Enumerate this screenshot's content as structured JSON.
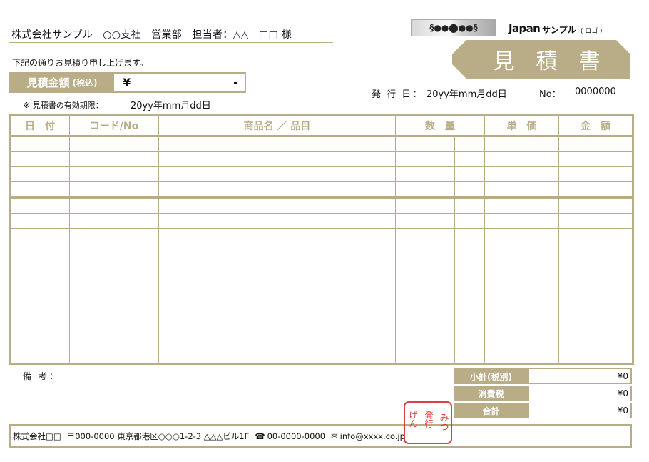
{
  "recipient": "株式会社サンプル　○○支社　営業部　担当者：△△　□□ 様",
  "intro": "下記の通りお見積り申し上げます。",
  "amount": {
    "label": "見積金額",
    "label_small": "(税込)",
    "yen": "¥",
    "value": "-"
  },
  "validity": {
    "label": "※ 見積書の有効期限：",
    "value": "20yy年mm月dd日"
  },
  "logo": {
    "graphic": "§●●⬤●●§",
    "text_en": "Japan",
    "text_jp": "サンプル",
    "text_jp_small": "( ロゴ )"
  },
  "title": "見積書",
  "issue": {
    "label": "発 行 日：",
    "date": "20yy年mm月dd日",
    "no_label": "No：",
    "no_value": "0000000"
  },
  "table": {
    "headers": [
      "日　付",
      "コード/No",
      "商品名 ／ 品目",
      "数　量",
      "単　価",
      "金　額"
    ],
    "row_count": 15
  },
  "remarks_label": "備 考：",
  "summary": [
    {
      "label": "小計(税別)",
      "value": "¥0"
    },
    {
      "label": "消費税",
      "value": "¥0"
    },
    {
      "label": "合計",
      "value": "¥0"
    }
  ],
  "footer": {
    "company": "株式会社□□",
    "address": "〒000-0000 東京都港区○○○1-2-3 △△△ビル1F",
    "phone_icon": "☎",
    "phone": "00-0000-0000",
    "mail_icon": "✉",
    "email": "info@xxxx.co.jp"
  },
  "stamp": {
    "text": "みつもり 発行 げんか"
  },
  "colors": {
    "accent": "#b9ad88",
    "stamp": "#d42020"
  }
}
